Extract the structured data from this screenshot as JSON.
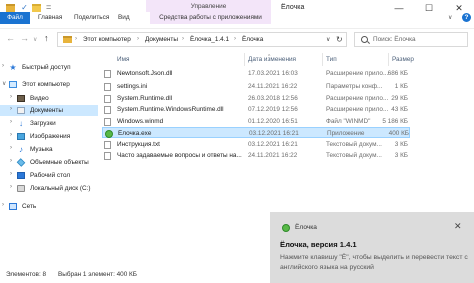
{
  "titlebar": {
    "window_title": "Ёлочка",
    "contextual_tab_group": "Управление",
    "minimize": "—",
    "maximize": "☐",
    "close": "✕",
    "qat_check": "✓",
    "qat_menu": "="
  },
  "ribbon": {
    "file_tab": "Файл",
    "tabs": [
      "Главная",
      "Поделиться",
      "Вид",
      "Средства работы с приложениями"
    ],
    "expand": "∨",
    "help": "?"
  },
  "addressbar": {
    "back": "←",
    "forward": "→",
    "recent": "∨",
    "up": "↑",
    "crumbs": [
      "Этот компьютер",
      "Документы",
      "Ёлочка_1.4.1",
      "Ёлочка"
    ],
    "separator": "›",
    "dropdown": "∨",
    "refresh": "↻",
    "search_placeholder": "Поиск: Ёлочка"
  },
  "sidebar": {
    "items": [
      {
        "label": "Быстрый доступ",
        "icon": "star-icon",
        "chevron": "›"
      },
      {
        "label": "Этот компьютер",
        "icon": "computer-icon",
        "chevron": "∨"
      },
      {
        "label": "Видео",
        "icon": "video-icon",
        "chevron": "›"
      },
      {
        "label": "Документы",
        "icon": "documents-icon",
        "chevron": "›"
      },
      {
        "label": "Загрузки",
        "icon": "downloads-icon",
        "chevron": "›"
      },
      {
        "label": "Изображения",
        "icon": "pictures-icon",
        "chevron": "›"
      },
      {
        "label": "Музыка",
        "icon": "music-icon",
        "chevron": "›"
      },
      {
        "label": "Объемные объекты",
        "icon": "3d-objects-icon",
        "chevron": "›"
      },
      {
        "label": "Рабочий стол",
        "icon": "desktop-icon",
        "chevron": "›"
      },
      {
        "label": "Локальный диск (C:)",
        "icon": "disk-icon",
        "chevron": "›"
      },
      {
        "label": "Сеть",
        "icon": "network-icon",
        "chevron": "›"
      }
    ]
  },
  "filelist": {
    "sort_arrow": "^",
    "columns": [
      "Имя",
      "Дата изменения",
      "Тип",
      "Размер"
    ],
    "rows": [
      {
        "name": "Newtonsoft.Json.dll",
        "date": "17.03.2021 16:03",
        "type": "Расширение прило...",
        "size": "686 КБ"
      },
      {
        "name": "settings.ini",
        "date": "24.11.2021 16:22",
        "type": "Параметры конф...",
        "size": "1 КБ"
      },
      {
        "name": "System.Runtime.dll",
        "date": "26.03.2018 12:56",
        "type": "Расширение прило...",
        "size": "29 КБ"
      },
      {
        "name": "System.Runtime.WindowsRuntime.dll",
        "date": "07.12.2019 12:56",
        "type": "Расширение прило...",
        "size": "43 КБ"
      },
      {
        "name": "Windows.winmd",
        "date": "01.12.2020 16:51",
        "type": "Файл \"WINMD\"",
        "size": "5 186 КБ"
      },
      {
        "name": "Ёлочка.exe",
        "date": "03.12.2021 16:21",
        "type": "Приложение",
        "size": "400 КБ"
      },
      {
        "name": "Инструкция.txt",
        "date": "03.12.2021 16:21",
        "type": "Текстовый докум...",
        "size": "3 КБ"
      },
      {
        "name": "Часто задаваемые вопросы и ответы на...",
        "date": "24.11.2021 16:22",
        "type": "Текстовый докум...",
        "size": "3 КБ"
      }
    ],
    "selected_index": 5
  },
  "statusbar": {
    "items_count": "Элементов: 8",
    "selected": "Выбран 1 элемент: 400 КБ"
  },
  "toast": {
    "app_name": "Ёлочка",
    "close": "✕",
    "title": "Ёлочка, версия 1.4.1",
    "body": "Нажмите клавишу \"Ё\", чтобы выделить и перевести текст с английского языка на русский"
  },
  "colors": {
    "accent": "#1a73d1",
    "selection": "#cce8ff",
    "contextual": "#f3e5f9",
    "toast_bg": "#dcdcdc"
  }
}
